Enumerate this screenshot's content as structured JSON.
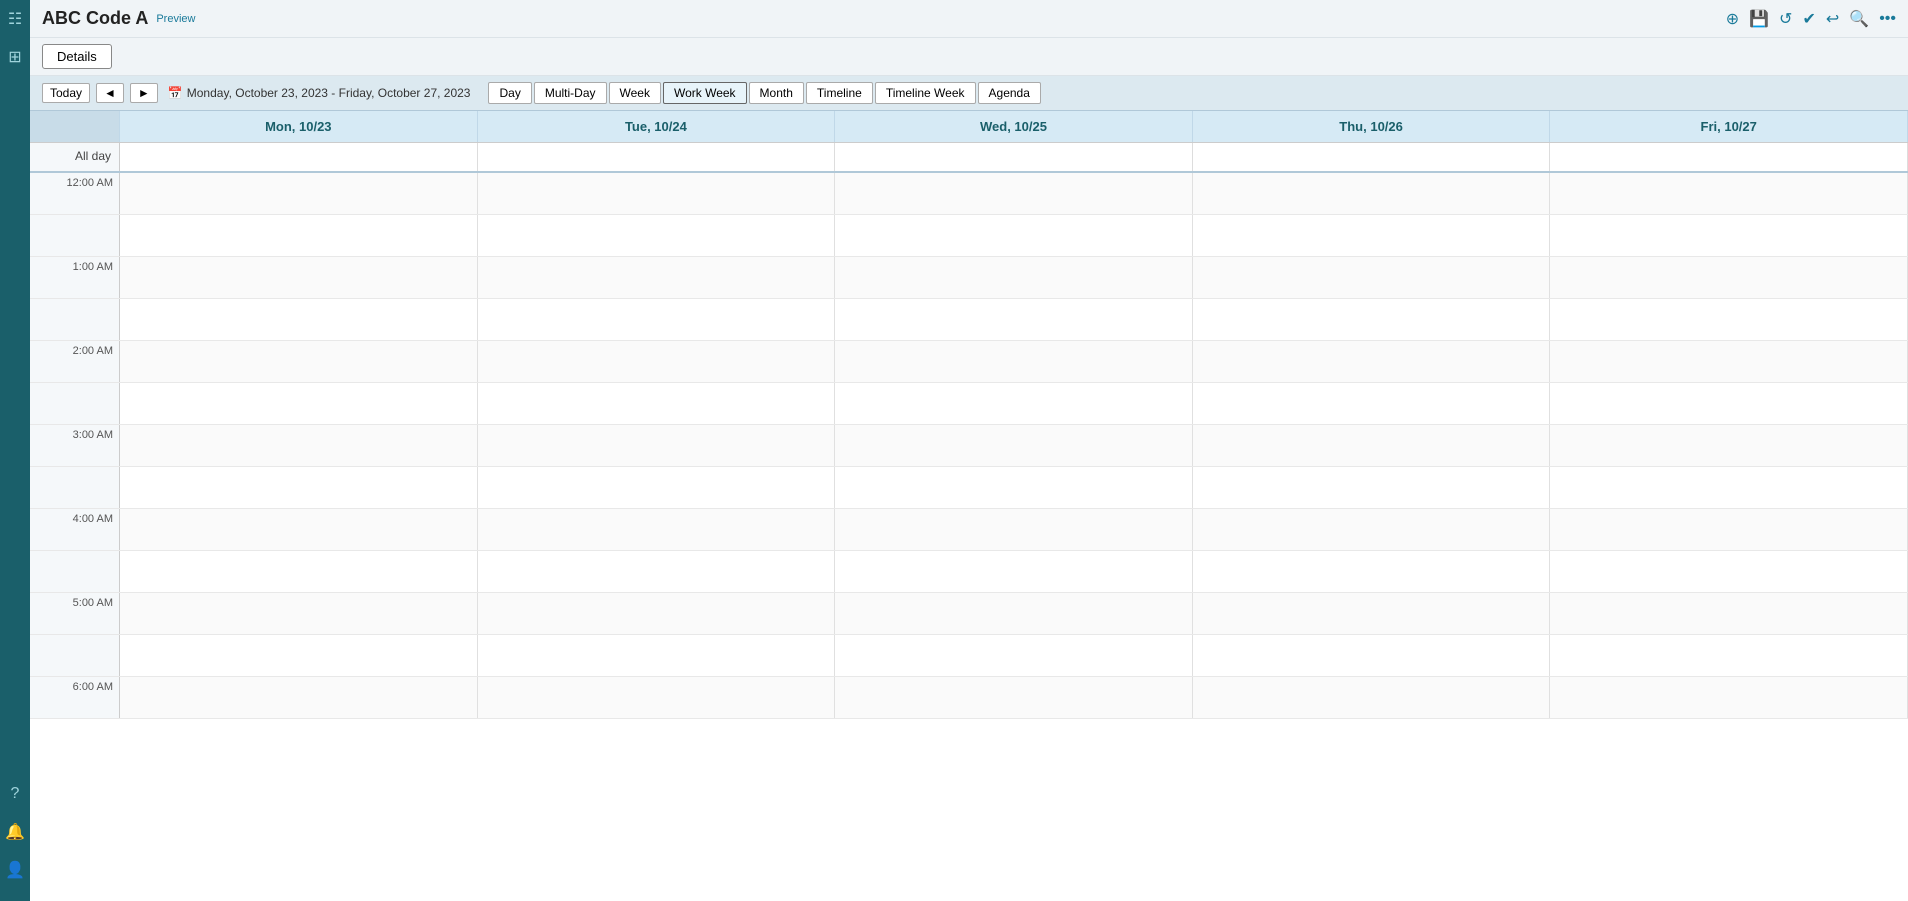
{
  "sidebar": {
    "icons": [
      "grid",
      "grid-small",
      "help",
      "bell",
      "user"
    ]
  },
  "topbar": {
    "title": "ABC Code A",
    "preview_badge": "Preview",
    "icons": [
      "plus-circle",
      "save",
      "refresh",
      "check",
      "undo",
      "search",
      "more"
    ]
  },
  "details_button": "Details",
  "calendar": {
    "nav": {
      "today_label": "Today",
      "prev_label": "◄",
      "next_label": "►",
      "date_range": "Monday, October 23, 2023 - Friday, October 27, 2023",
      "cal_icon": "📅"
    },
    "views": [
      {
        "label": "Day",
        "active": false
      },
      {
        "label": "Multi-Day",
        "active": false
      },
      {
        "label": "Week",
        "active": false
      },
      {
        "label": "Work Week",
        "active": true
      },
      {
        "label": "Month",
        "active": false
      },
      {
        "label": "Timeline",
        "active": false
      },
      {
        "label": "Timeline Week",
        "active": false
      },
      {
        "label": "Agenda",
        "active": false
      }
    ],
    "header_cols": [
      {
        "label": "",
        "key": "time"
      },
      {
        "label": "Mon, 10/23",
        "key": "mon"
      },
      {
        "label": "Tue, 10/24",
        "key": "tue"
      },
      {
        "label": "Wed, 10/25",
        "key": "wed"
      },
      {
        "label": "Thu, 10/26",
        "key": "thu"
      },
      {
        "label": "Fri, 10/27",
        "key": "fri"
      }
    ],
    "allday_label": "All day",
    "time_slots": [
      "12:00 AM",
      "",
      "1:00 AM",
      "",
      "2:00 AM",
      "",
      "3:00 AM",
      "",
      "4:00 AM",
      "",
      "5:00 AM",
      "",
      "6:00 AM"
    ]
  }
}
